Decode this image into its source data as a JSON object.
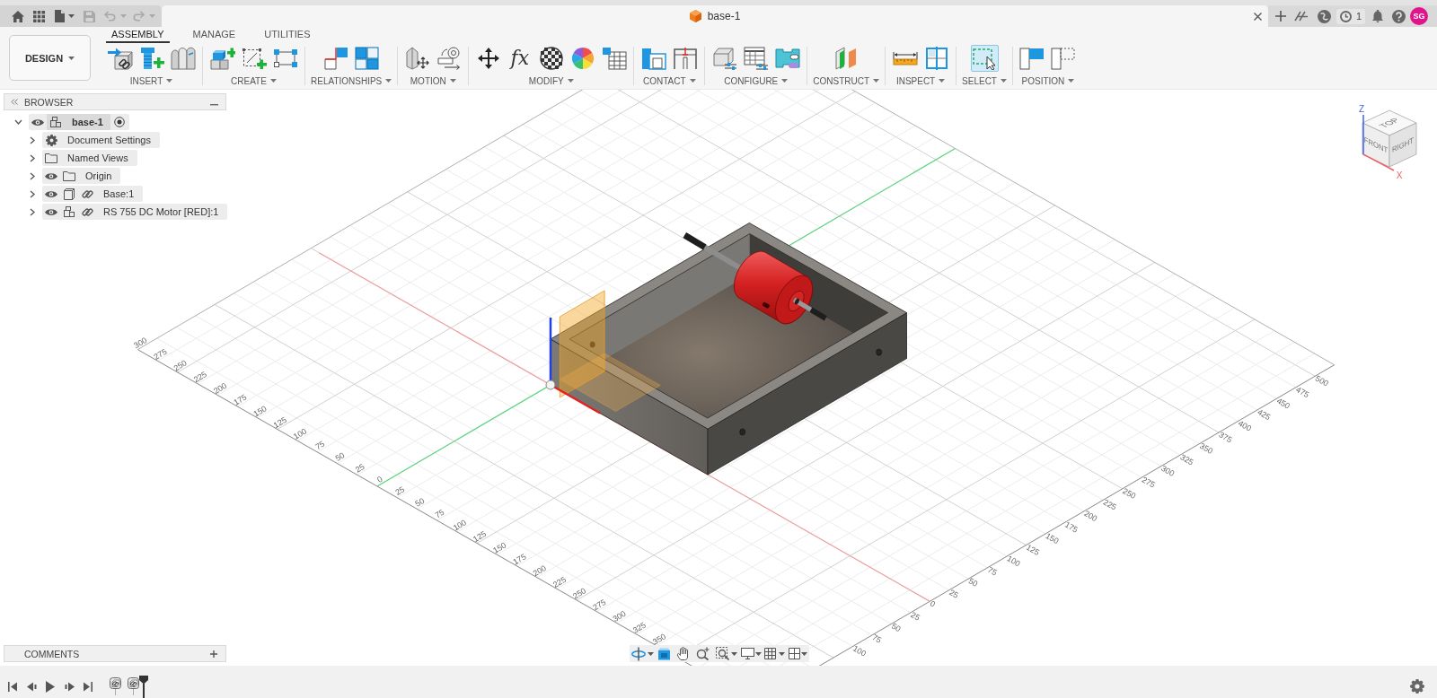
{
  "quick_access": [
    {
      "disabled": false
    },
    {
      "disabled": false
    },
    {
      "disabled": false
    },
    {
      "disabled": true
    },
    {
      "disabled": true
    },
    {
      "disabled": true
    }
  ],
  "document_tab": {
    "title": "base-1"
  },
  "job_status": {
    "count": "1"
  },
  "user": {
    "initials": "SG"
  },
  "workspace": {
    "label": "DESIGN"
  },
  "toolbar_tabs": [
    {
      "label": "ASSEMBLY",
      "selected": true
    },
    {
      "label": "MANAGE",
      "selected": false
    },
    {
      "label": "UTILITIES",
      "selected": false
    }
  ],
  "tool_groups": [
    {
      "label": "INSERT",
      "tools": [
        {
          "active": false
        },
        {
          "active": false
        },
        {
          "active": false
        }
      ]
    },
    {
      "label": "CREATE",
      "tools": [
        {
          "active": false
        },
        {
          "active": false
        },
        {
          "active": false
        }
      ]
    },
    {
      "label": "RELATIONSHIPS",
      "tools": [
        {
          "active": false
        },
        {
          "active": false
        }
      ]
    },
    {
      "label": "MOTION",
      "tools": [
        {
          "active": false
        },
        {
          "active": false
        }
      ]
    },
    {
      "label": "MODIFY",
      "tools": [
        {
          "active": false
        },
        {
          "active": false,
          "glyph": "fx"
        },
        {
          "active": false
        },
        {
          "active": false
        },
        {
          "active": false
        }
      ]
    },
    {
      "label": "CONTACT",
      "tools": [
        {
          "active": false
        },
        {
          "active": false
        }
      ]
    },
    {
      "label": "CONFIGURE",
      "tools": [
        {
          "active": false
        },
        {
          "active": false
        },
        {
          "active": false
        }
      ]
    },
    {
      "label": "CONSTRUCT",
      "tools": [
        {
          "active": false
        }
      ]
    },
    {
      "label": "INSPECT",
      "tools": [
        {
          "active": false
        },
        {
          "active": false
        }
      ]
    },
    {
      "label": "SELECT",
      "tools": [
        {
          "active": true
        }
      ]
    },
    {
      "label": "POSITION",
      "tools": [
        {
          "active": false
        },
        {
          "active": false
        }
      ]
    }
  ],
  "browser": {
    "title": "BROWSER",
    "tree": [
      {
        "label": "base-1",
        "kind": "component",
        "expanded": true,
        "visible": true,
        "activated": true,
        "children": [
          {
            "label": "Document Settings",
            "kind": "settings",
            "expanded": false
          },
          {
            "label": "Named Views",
            "kind": "folder",
            "expanded": false
          },
          {
            "label": "Origin",
            "kind": "folder",
            "expanded": false,
            "visible": true
          },
          {
            "label": "Base:1",
            "kind": "body",
            "expanded": false,
            "visible": true,
            "linked": true
          },
          {
            "label": "RS 755 DC Motor [RED]:1",
            "kind": "component",
            "expanded": false,
            "visible": true,
            "linked": true
          }
        ]
      }
    ]
  },
  "viewport": {
    "grid": {
      "left_ruler": [
        "300",
        "275",
        "250",
        "225",
        "200",
        "175",
        "150",
        "125",
        "100",
        "75",
        "50",
        "25",
        "0",
        "25",
        "50",
        "75",
        "100",
        "125",
        "150",
        "175",
        "200",
        "225",
        "250",
        "275",
        "300",
        "325",
        "350"
      ],
      "right_ruler": [
        "100",
        "75",
        "50",
        "25",
        "0",
        "25",
        "50",
        "75",
        "100",
        "125",
        "150",
        "175",
        "200",
        "225",
        "250",
        "275",
        "300",
        "325",
        "350",
        "375",
        "400",
        "425",
        "450",
        "475",
        "500"
      ]
    },
    "view_cube": {
      "top": "TOP",
      "front": "FRONT",
      "right": "RIGHT",
      "z_axis": "Z",
      "x_axis": "X"
    }
  },
  "comments": {
    "title": "COMMENTS"
  }
}
